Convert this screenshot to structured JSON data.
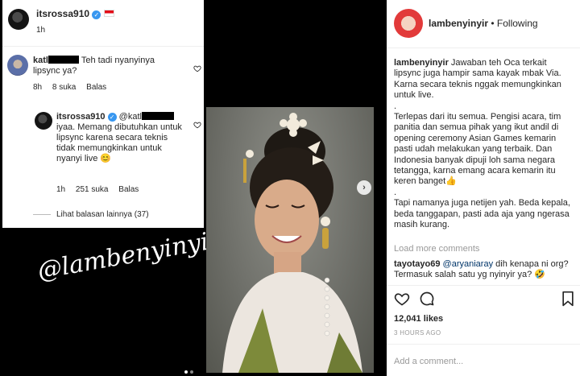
{
  "comment_card": {
    "post_username": "itsrossa910",
    "post_time": "1h",
    "comment": {
      "username_visible": "katl",
      "text": "Teh tadi nyanyinya lipsync ya?",
      "time": "8h",
      "likes": "8 suka",
      "reply_label": "Balas"
    },
    "reply": {
      "username": "itsrossa910",
      "mention_visible": "@katl",
      "text": "iyaa. Memang dibutuhkan untuk lipsync  karena secara teknis tidak memungkinkan untuk nyanyi live",
      "emoji": "😊",
      "time": "1h",
      "likes": "251 suka",
      "reply_label": "Balas"
    },
    "view_replies": "Lihat balasan lainnya (37)"
  },
  "media": {
    "watermark": "@lambenyinyir",
    "carousel_total": 2,
    "carousel_active": 1
  },
  "panel": {
    "username": "lambenyinyir",
    "follow_status": "• Following",
    "caption_lines": [
      "lambenyinyir Jawaban teh Oca terkait lipsync juga hampir sama kayak mbak Via. Karna secara teknis nggak memungkinkan untuk live.",
      ".",
      "Terlepas dari itu semua. Pengisi acara, tim panitia dan semua pihak yang ikut andil di opening ceremony Asian Games kemarin pasti udah melakukan yang terbaik. Dan Indonesia banyak dipuji loh sama negara tetangga, karna emang acara kemarin itu keren banget👍",
      ".",
      "Tapi namanya juga netijen yah. Beda kepala, beda tanggapan, pasti ada aja yang ngerasa masih kurang."
    ],
    "load_more": "Load more comments",
    "comment": {
      "username": "tayotayo69",
      "mention": "@aryaniaray",
      "text": "dih kenapa ni org? Termasuk salah satu yg nyinyir ya? 🤣"
    },
    "likes": "12,041 likes",
    "time_ago": "3 HOURS AGO",
    "add_comment_placeholder": "Add a comment..."
  },
  "icons": [
    "heart-icon",
    "comment-icon",
    "bookmark-icon",
    "verified-icon",
    "flag-icon",
    "chevron-right-icon"
  ],
  "colors": {
    "verified": "#3897f0",
    "text": "#262626",
    "muted": "#999999",
    "flag_red": "#e30a17"
  }
}
